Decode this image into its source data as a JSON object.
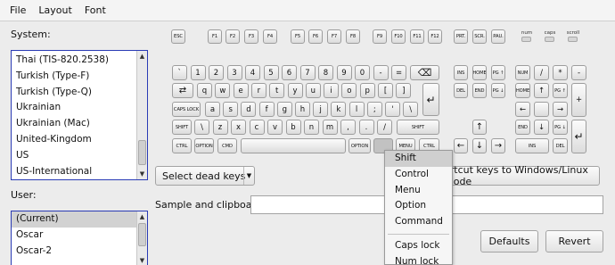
{
  "menubar": {
    "items": [
      "File",
      "Layout",
      "Font"
    ]
  },
  "system": {
    "label": "System:",
    "items": [
      "Thai (TIS-820.2538)",
      "Turkish (Type-F)",
      "Turkish (Type-Q)",
      "Ukrainian",
      "Ukrainian (Mac)",
      "United-Kingdom",
      "US",
      "US-International"
    ]
  },
  "user": {
    "label": "User:",
    "items": [
      "(Current)",
      "Oscar",
      "Oscar-2"
    ],
    "selected_index": 0
  },
  "dead_keys": {
    "value": "Select dead keys"
  },
  "shortcut_button": {
    "label": "ortcut keys to Windows/Linux mode"
  },
  "sample": {
    "label": "Sample and clipboard:",
    "value": ""
  },
  "buttons": {
    "defaults": "Defaults",
    "revert": "Revert"
  },
  "popup": {
    "items": [
      "Shift",
      "Control",
      "Menu",
      "Option",
      "Command",
      "---",
      "Caps lock",
      "Num lock"
    ],
    "selected_index": 0
  },
  "leds": {
    "num": "num",
    "caps": "caps",
    "scroll": "scroll"
  },
  "icons": {
    "backspace": "backspace-icon",
    "tab": "tab-icon",
    "enter": "enter-icon",
    "arrow_up": "arrow-up-icon",
    "arrow_left": "arrow-left-icon",
    "arrow_down": "arrow-down-icon",
    "arrow_right": "arrow-right-icon"
  },
  "keyboard": {
    "fn_row": [
      "ESC",
      "F1",
      "F2",
      "F3",
      "F4",
      "F5",
      "F6",
      "F7",
      "F8",
      "F9",
      "F10",
      "F11",
      "F12",
      "PRT.",
      "SCR.",
      "PAU."
    ],
    "row1": [
      "`",
      "1",
      "2",
      "3",
      "4",
      "5",
      "6",
      "7",
      "8",
      "9",
      "0",
      "-",
      "="
    ],
    "row2": [
      "q",
      "w",
      "e",
      "r",
      "t",
      "y",
      "u",
      "i",
      "o",
      "p",
      "[",
      "]"
    ],
    "row3_caps": "CAPS LOCK",
    "row3": [
      "a",
      "s",
      "d",
      "f",
      "g",
      "h",
      "j",
      "k",
      "l",
      ";",
      "'",
      "\\"
    ],
    "row4_shift_left": "SHIFT",
    "row4": [
      "\\",
      "z",
      "x",
      "c",
      "v",
      "b",
      "n",
      "m",
      ",",
      ".",
      "/"
    ],
    "row4_shift_right": "SHIFT",
    "row5": {
      "ctrl_left": "CTRL",
      "option_left": "OPTION",
      "cmd_left": "CMD",
      "space": "",
      "option_right": "OPTION",
      "right_blank": "",
      "menu": "MENU",
      "ctrl_right": "CTRL"
    },
    "nav": {
      "ins": "INS",
      "home": "HOME",
      "pgup": "PG ↑",
      "del": "DEL",
      "end": "END",
      "pgdn": "PG ↓"
    },
    "numpad": {
      "row1": [
        "NUM",
        "/",
        "*",
        "-"
      ],
      "row2": [
        "HOME",
        "↑",
        "PG ↑",
        "+"
      ],
      "row3": [
        "←",
        "",
        "→"
      ],
      "row4": [
        "END",
        "↓",
        "PG ↓"
      ],
      "row5": [
        "INS",
        "DEL"
      ]
    }
  }
}
